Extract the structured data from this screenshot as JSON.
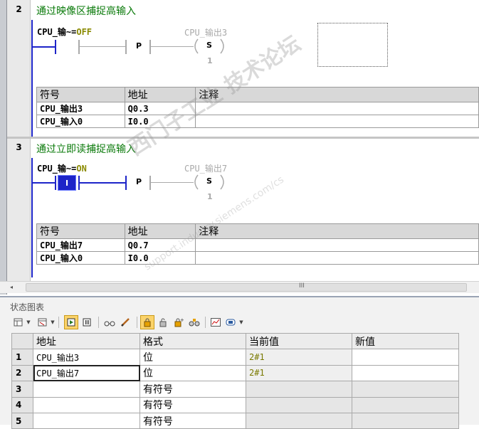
{
  "networks": [
    {
      "number": "2",
      "title": "通过映像区捕捉高输入",
      "input_label": "CPU_输~=OFF",
      "input_label_main": "CPU_输~=",
      "input_state": "OFF",
      "contact_mark": "",
      "edge": "P",
      "coil_name": "CPU_输出3",
      "coil_type": "S",
      "coil_count": "1",
      "symbols": {
        "headers": [
          "符号",
          "地址",
          "注释"
        ],
        "rows": [
          {
            "symbol": "CPU_输出3",
            "address": "Q0.3",
            "comment": ""
          },
          {
            "symbol": "CPU_输入0",
            "address": "I0.0",
            "comment": ""
          }
        ]
      }
    },
    {
      "number": "3",
      "title": "通过立即读捕捉高输入",
      "input_label": "CPU_输~=ON",
      "input_label_main": "CPU_输~=",
      "input_state": "ON",
      "contact_mark": "I",
      "edge": "P",
      "coil_name": "CPU_输出7",
      "coil_type": "S",
      "coil_count": "1",
      "symbols": {
        "headers": [
          "符号",
          "地址",
          "注释"
        ],
        "rows": [
          {
            "symbol": "CPU_输出7",
            "address": "Q0.7",
            "comment": ""
          },
          {
            "symbol": "CPU_输入0",
            "address": "I0.0",
            "comment": ""
          }
        ]
      }
    }
  ],
  "editor_scroll": {
    "thumb_glyph": "III"
  },
  "status_chart": {
    "title": "状态图表",
    "columns": [
      "地址",
      "格式",
      "当前值",
      "新值"
    ],
    "rows": [
      {
        "num": "1",
        "address": "CPU_输出3",
        "format": "位",
        "current": "2#1",
        "new": ""
      },
      {
        "num": "2",
        "address": "CPU_输出7",
        "format": "位",
        "current": "2#1",
        "new": ""
      },
      {
        "num": "3",
        "address": "",
        "format": "有符号",
        "current": "",
        "new": ""
      },
      {
        "num": "4",
        "address": "",
        "format": "有符号",
        "current": "",
        "new": ""
      },
      {
        "num": "5",
        "address": "",
        "format": "有符号",
        "current": "",
        "new": ""
      }
    ]
  },
  "watermark": {
    "main": "西门子工业 技术论坛",
    "sub": "support.industry.siemens.com/cs"
  },
  "colors": {
    "rail": "#1d24c8",
    "title_green": "#0a7a0a",
    "value_olive": "#7a7a00",
    "pressed": "#fbd36a"
  }
}
